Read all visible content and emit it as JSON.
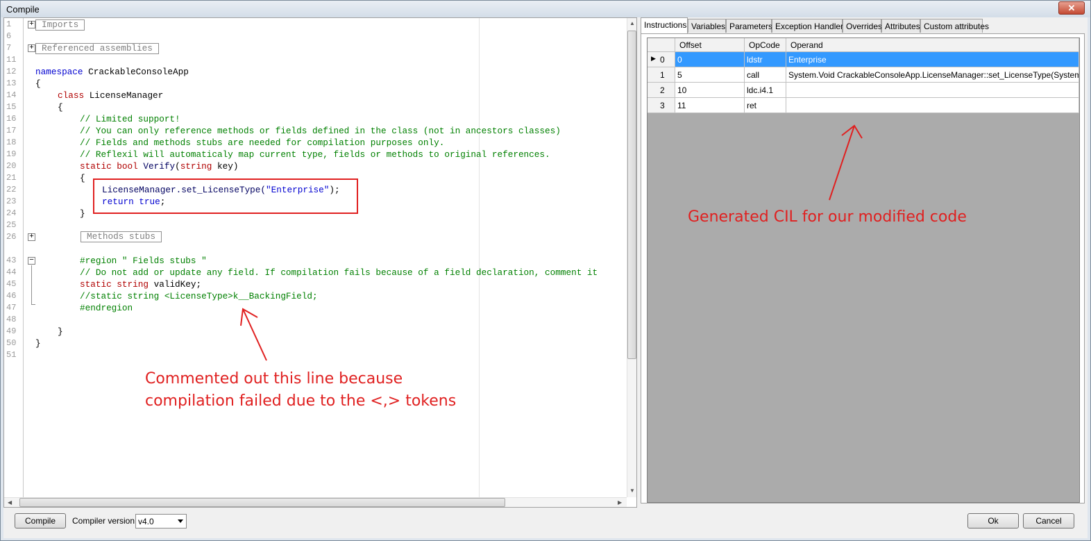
{
  "window": {
    "title": "Compile",
    "close_glyph": "✕"
  },
  "editor": {
    "line_numbers": [
      "1",
      "6",
      "7",
      "11",
      "12",
      "13",
      "14",
      "15",
      "16",
      "17",
      "18",
      "19",
      "20",
      "21",
      "22",
      "23",
      "24",
      "25",
      "26",
      "43",
      "44",
      "45",
      "46",
      "47",
      "48",
      "49",
      "50",
      "51"
    ],
    "imports_label": "Imports",
    "referenced_assemblies_label": "Referenced assemblies",
    "methods_stubs_label": "Methods stubs",
    "lines": {
      "namespace_kw": "namespace",
      "namespace_name": " CrackableConsoleApp",
      "open_brace_ns": "{",
      "class_kw": "class",
      "class_name": " LicenseManager",
      "open_brace_class": "{",
      "comment1": "// Limited support!",
      "comment2": "// You can only reference methods or fields defined in the class (not in ancestors classes)",
      "comment3": "// Fields and methods stubs are needed for compilation purposes only.",
      "comment4": "// Reflexil will automaticaly map current type, fields or methods to original references.",
      "static_kw": "static",
      "bool_kw": " bool",
      "method_name": " Verify",
      "method_open_paren": "(",
      "string_kw": "string",
      "param": " key)",
      "open_brace_method": "{",
      "call_target": "LicenseManager.set_LicenseType(",
      "call_arg": "\"Enterprise\"",
      "call_end": ");",
      "return_kw": "return",
      "true_kw": " true",
      "return_end": ";",
      "close_brace_method": "}",
      "region_start": "#region \" Fields stubs \"",
      "comment5": "// Do not add or update any field. If compilation fails because of a field declaration, comment it",
      "field_static_kw": "static",
      "field_string_kw": " string",
      "field_name": " validKey;",
      "comment6": "//static string <LicenseType>k__BackingField;",
      "region_end": "#endregion",
      "close_brace_class": "}",
      "close_brace_ns": "}"
    }
  },
  "tabs": [
    "Instructions",
    "Variables",
    "Parameters",
    "Exception Handlers",
    "Overrides",
    "Attributes",
    "Custom attributes"
  ],
  "instructions": {
    "columns": [
      "Offset",
      "OpCode",
      "Operand"
    ],
    "rows": [
      {
        "index": "0",
        "offset": "0",
        "opcode": "ldstr",
        "operand": "Enterprise"
      },
      {
        "index": "1",
        "offset": "5",
        "opcode": "call",
        "operand": "System.Void CrackableConsoleApp.LicenseManager::set_LicenseType(System.String)"
      },
      {
        "index": "2",
        "offset": "10",
        "opcode": "ldc.i4.1",
        "operand": ""
      },
      {
        "index": "3",
        "offset": "11",
        "opcode": "ret",
        "operand": ""
      }
    ]
  },
  "bottom": {
    "compile_label": "Compile",
    "compiler_version_label": "Compiler version:",
    "compiler_version_value": "v4.0",
    "ok_label": "Ok",
    "cancel_label": "Cancel"
  },
  "annotations": {
    "left_line1": "Commented out this line because",
    "left_line2": "compilation failed due to the <,> tokens",
    "right": "Generated CIL for our modified code",
    "color": "#e02020"
  }
}
